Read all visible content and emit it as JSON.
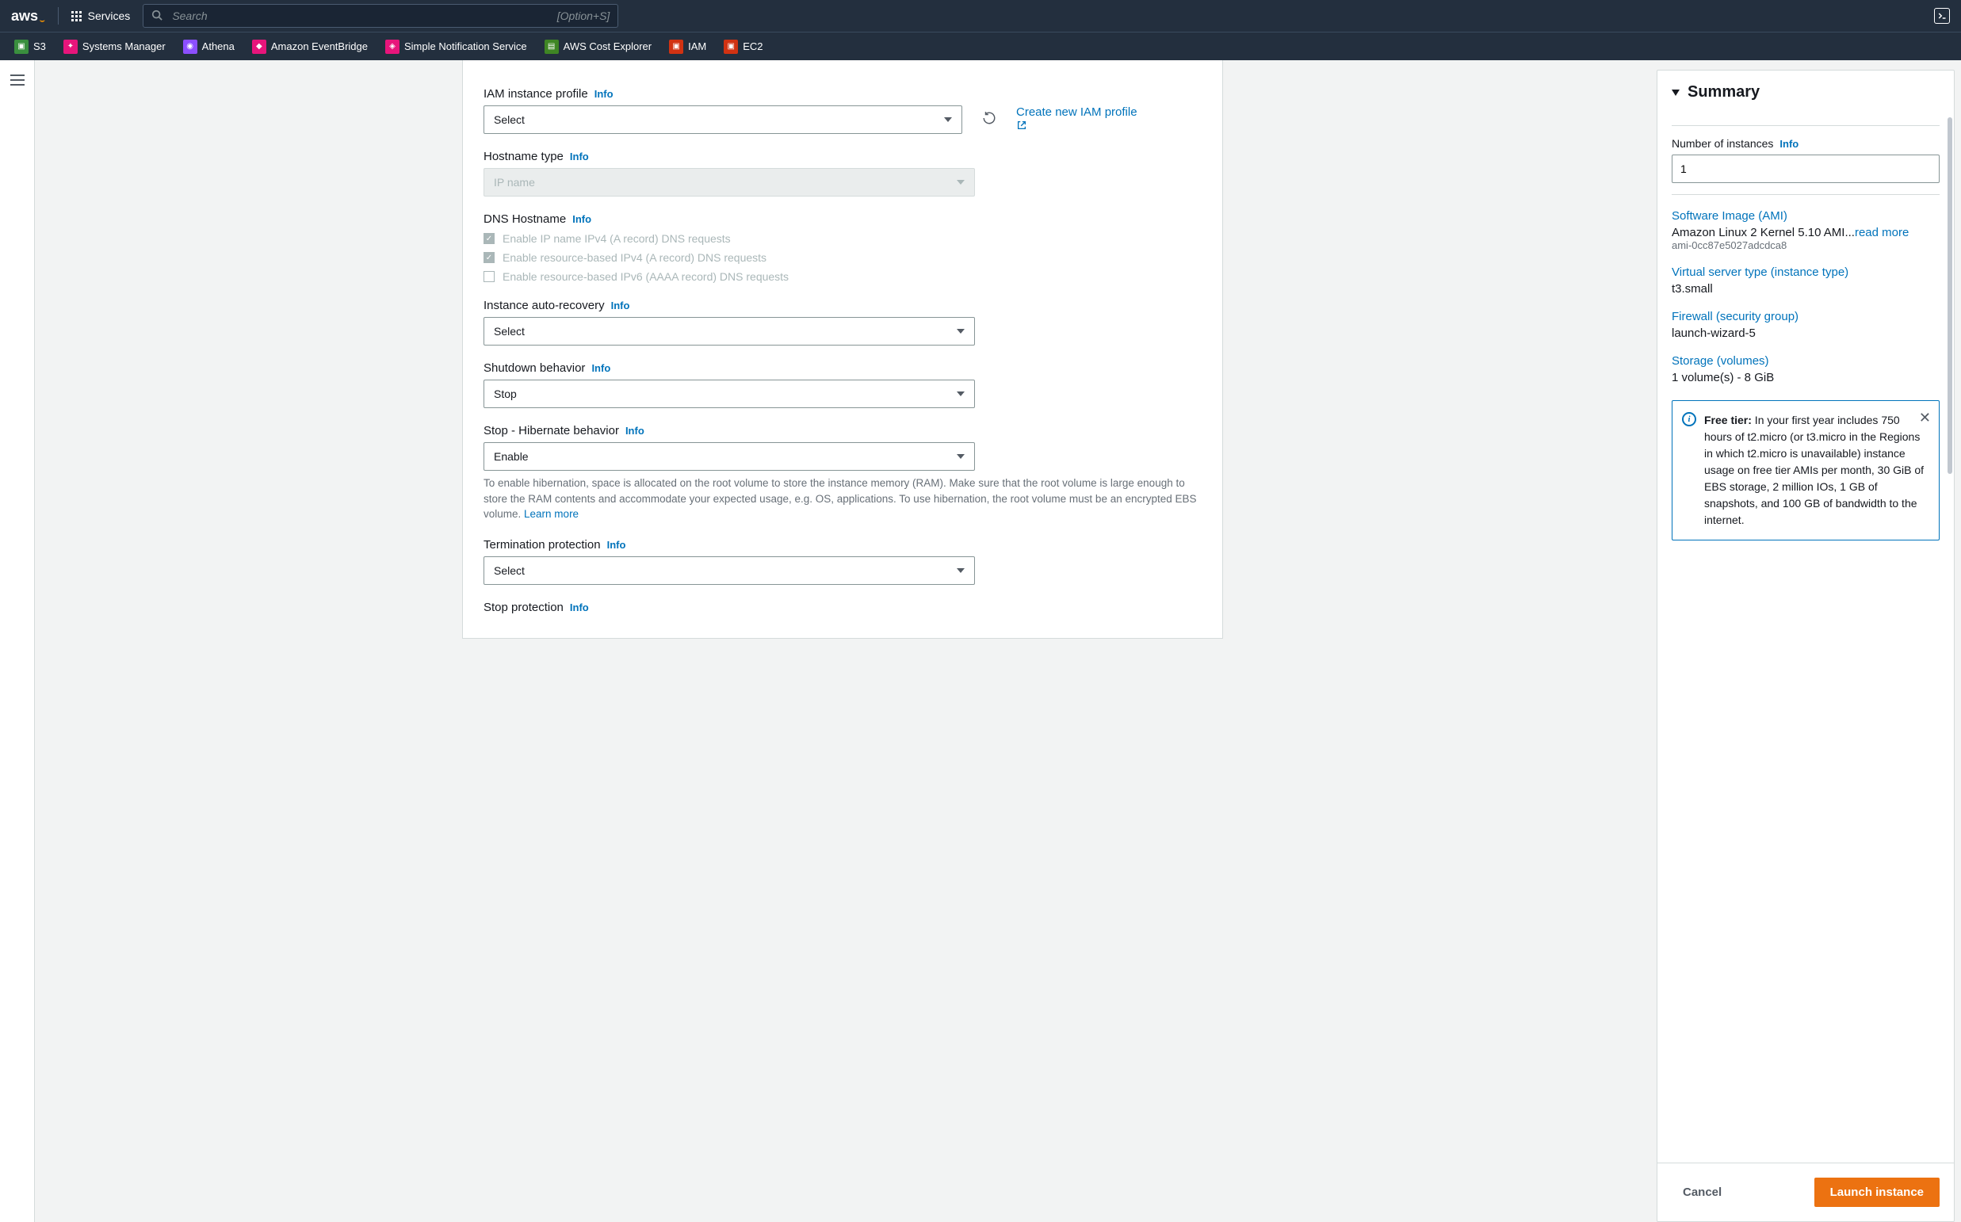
{
  "topnav": {
    "logo": "aws",
    "services_label": "Services",
    "search_placeholder": "Search",
    "search_kbd": "[Option+S]"
  },
  "favorites": [
    {
      "label": "S3",
      "color": "fi-green"
    },
    {
      "label": "Systems Manager",
      "color": "fi-red"
    },
    {
      "label": "Athena",
      "color": "fi-purple"
    },
    {
      "label": "Amazon EventBridge",
      "color": "fi-red"
    },
    {
      "label": "Simple Notification Service",
      "color": "fi-red"
    },
    {
      "label": "AWS Cost Explorer",
      "color": "fi-blue"
    },
    {
      "label": "IAM",
      "color": "fi-ored"
    },
    {
      "label": "EC2",
      "color": "fi-ored"
    }
  ],
  "form": {
    "info_link": "Info",
    "iam": {
      "label": "IAM instance profile",
      "value": "Select",
      "action": "Create new IAM profile"
    },
    "hostname": {
      "label": "Hostname type",
      "value": "IP name"
    },
    "dns": {
      "label": "DNS Hostname",
      "opt1": "Enable IP name IPv4 (A record) DNS requests",
      "opt2": "Enable resource-based IPv4 (A record) DNS requests",
      "opt3": "Enable resource-based IPv6 (AAAA record) DNS requests"
    },
    "autorecovery": {
      "label": "Instance auto-recovery",
      "value": "Select"
    },
    "shutdown": {
      "label": "Shutdown behavior",
      "value": "Stop"
    },
    "hibernate": {
      "label": "Stop - Hibernate behavior",
      "value": "Enable",
      "help": "To enable hibernation, space is allocated on the root volume to store the instance memory (RAM). Make sure that the root volume is large enough to store the RAM contents and accommodate your expected usage, e.g. OS, applications. To use hibernation, the root volume must be an encrypted EBS volume. ",
      "learn": "Learn more"
    },
    "termination": {
      "label": "Termination protection",
      "value": "Select"
    },
    "stopprotect": {
      "label": "Stop protection"
    }
  },
  "summary": {
    "title": "Summary",
    "instances_label": "Number of instances",
    "instances_value": "1",
    "ami_head": "Software Image (AMI)",
    "ami_val": "Amazon Linux 2 Kernel 5.10 AMI...",
    "ami_readmore": "read more",
    "ami_id": "ami-0cc87e5027adcdca8",
    "type_head": "Virtual server type (instance type)",
    "type_val": "t3.small",
    "sg_head": "Firewall (security group)",
    "sg_val": "launch-wizard-5",
    "storage_head": "Storage (volumes)",
    "storage_val": "1 volume(s) - 8 GiB",
    "free_tier_strong": "Free tier:",
    "free_tier_text": " In your first year includes 750 hours of t2.micro (or t3.micro in the Regions in which t2.micro is unavailable) instance usage on free tier AMIs per month, 30 GiB of EBS storage, 2 million IOs, 1 GB of snapshots, and 100 GB of bandwidth to the internet.",
    "cancel": "Cancel",
    "launch": "Launch instance"
  }
}
